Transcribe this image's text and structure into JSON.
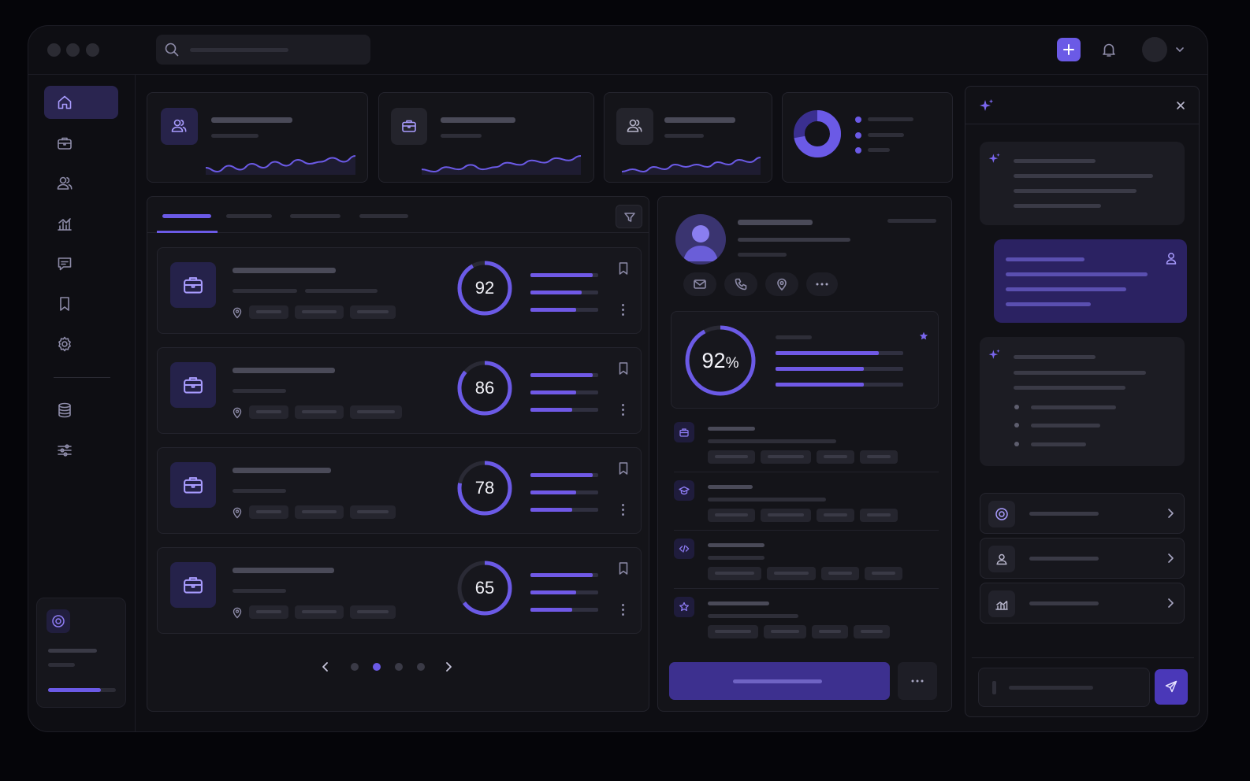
{
  "window": {
    "controls": [
      "close",
      "minimize",
      "maximize"
    ]
  },
  "topbar": {
    "search_icon": "search-icon",
    "actions": [
      "plus-icon",
      "bell-icon",
      "avatar",
      "chevron-down-icon"
    ]
  },
  "sidebar": {
    "items": [
      {
        "id": "home",
        "icon": "home-icon",
        "active": true
      },
      {
        "id": "jobs",
        "icon": "briefcase-icon"
      },
      {
        "id": "people",
        "icon": "users-icon"
      },
      {
        "id": "analytics",
        "icon": "chart-icon"
      },
      {
        "id": "messages",
        "icon": "message-icon"
      },
      {
        "id": "saved",
        "icon": "bookmark-icon"
      },
      {
        "id": "settings",
        "icon": "gear-icon"
      },
      {
        "id": "database",
        "icon": "database-icon"
      },
      {
        "id": "filters",
        "icon": "sliders-icon"
      }
    ],
    "promo": {
      "icon": "target-icon",
      "progress": 0.78
    }
  },
  "stats": [
    {
      "icon": "users-icon",
      "sparkline": [
        6,
        4,
        7,
        5,
        8,
        6,
        9,
        7,
        10,
        8,
        9,
        11,
        9,
        12
      ]
    },
    {
      "icon": "briefcase-icon",
      "sparkline": [
        5,
        4,
        6,
        5,
        7,
        5,
        6,
        8,
        7,
        9,
        8,
        10,
        9,
        11
      ]
    },
    {
      "icon": "users-icon",
      "sparkline": [
        4,
        5,
        4,
        6,
        5,
        7,
        6,
        7,
        6,
        8,
        7,
        9,
        8,
        10
      ]
    },
    {
      "type": "donut",
      "value": 0.72,
      "legend_count": 3
    }
  ],
  "list": {
    "active_tab": 0,
    "tab_count": 4,
    "filter_icon": "filter-icon",
    "jobs": [
      {
        "score": "92",
        "score_value": 0.92,
        "bars": [
          0.92,
          0.75,
          0.68
        ]
      },
      {
        "score": "86",
        "score_value": 0.86,
        "bars": [
          0.92,
          0.68,
          0.62
        ]
      },
      {
        "score": "78",
        "score_value": 0.78,
        "bars": [
          0.92,
          0.68,
          0.62
        ]
      },
      {
        "score": "65",
        "score_value": 0.65,
        "bars": [
          0.92,
          0.68,
          0.62
        ]
      }
    ],
    "pagination": {
      "pages": 4,
      "active": 1
    }
  },
  "profile": {
    "contact_actions": [
      "mail-icon",
      "phone-icon",
      "location-icon",
      "more-icon"
    ],
    "match": {
      "number": "92",
      "unit": "%",
      "value": 0.92,
      "bars": [
        0.81,
        0.69,
        0.69
      ]
    },
    "timeline": [
      {
        "icon": "briefcase-icon",
        "chips": 4
      },
      {
        "icon": "graduation-cap-icon",
        "chips": 4
      },
      {
        "icon": "code-icon",
        "chips": 4
      },
      {
        "icon": "star-icon",
        "chips": 4
      }
    ]
  },
  "assistant": {
    "header_icon": "sparkle-icon",
    "close_icon": "close-icon",
    "links": [
      {
        "icon": "target-icon"
      },
      {
        "icon": "user-icon"
      },
      {
        "icon": "chart-icon"
      }
    ],
    "send_icon": "send-icon"
  },
  "colors": {
    "accent": "#6b5ae6",
    "accent_dark": "#3a2f8f",
    "panel": "#141419",
    "background": "#050509"
  }
}
